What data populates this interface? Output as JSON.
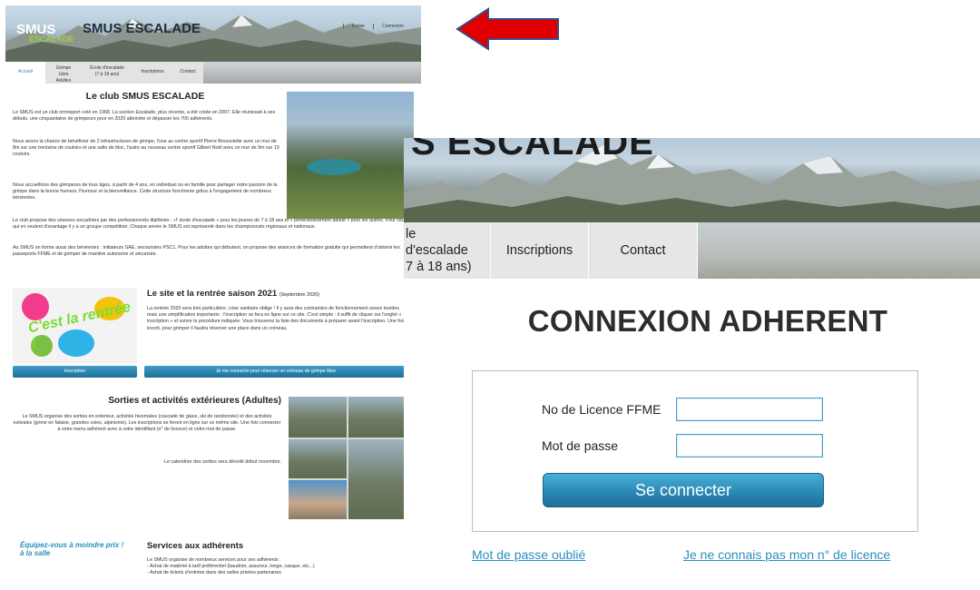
{
  "site": {
    "title": "SMUS ESCALADE",
    "logo_text": "SMUS",
    "logo_sub": "ESCALADE",
    "top_links": [
      "Panier",
      "Connexion"
    ],
    "nav": [
      {
        "label": "Accueil"
      },
      {
        "label": "Grimpe\nLibre Adultes"
      },
      {
        "label": "École d'escalade\n(7 à 18 ans)"
      },
      {
        "label": "Inscriptions"
      },
      {
        "label": "Contact"
      }
    ],
    "club": {
      "heading": "Le club SMUS ESCALADE",
      "p1": "Le SMUS est un club omnisport créé en 1968. La section Escalade, plus récente, a été créée en 2007. Elle réunissait à ses débuts, une cinquantaine de grimpeurs pour en 2020 atteindre et dépasser les 700 adhérents.",
      "p2": "Nous avons la chance de bénéficier de 2 infrastructures de grimpe, l'une au centre sportif Pierre Brossolette avec un mur de 8m sur une trentaine de couloirs et une salle de bloc, l'autre au nouveau centre sportif Gilbert Noël avec un mur de 9m sur 19 couloirs.",
      "p3": "Nous accueillons des grimpeurs de tous âges, à partir de 4 ans, en individuel ou en famille pour partager notre passion de la grimpe dans la bonne humeur, l'humour et la bienveillance. Cette structure fonctionne grâce à l'engagement de nombreux bénévoles.",
      "p4": "Le club propose des séances encadrées par des professionnels diplômés : «l' école d'escalade » pour les jeunes de 7 à 18 ans et « perfectionnement adulte » pour les autres. Pour ceux qui en veulent d'avantage il y a un groupe compétition. Chaque année le SMUS est représenté dans les championnats régionaux et nationaux.",
      "p5": "Au SMUS on forme aussi des bénévoles : initiateurs SAE, secouristes PSC1. Pour les adultes qui débutent, on propose des séances de formation gratuite qui permettent d'obtenir les passeports FFME et de grimper de manière autonome et sécurisée."
    },
    "rentree": {
      "image_text": "C'est la rentrée !",
      "heading": "Le site et la rentrée saison 2021",
      "heading_note": "(Septembre 2020)",
      "text": "La rentrée 2020 sera très particulière, crise sanitaire oblige ! Il y aura des contraintes de fonctionnement assez lourdes mais une simplification importante : l'inscription se fera en ligne sur ce site. C'est simple : il suffit de cliquer sur l'onglet « inscription » et suivre la procédure indiquée. Vous trouverez la liste des documents à préparer avant l'inscription. Une fois inscrit, pour grimper il faudra réserver une place dans un créneau.",
      "btn_inscription": "Inscription",
      "btn_reserver": "Je me connecte pour réserver un créneau de grimpe libre"
    },
    "sorties": {
      "heading": "Sorties et activités extérieures (Adultes)",
      "text": "Le SMUS organise des sorties en exterieur, activités hivernales (cascade de glace, ski de randonnée) et des activités estivales (grime en falaise, grandes voies, alpinisme). Les inscriptions se feront en ligne sur ce même site. Une fois connecter à votre menu adhérent avec à votre identifiant (n° de licence) et votre mot de passe.",
      "text2": "Le calendrier des sorties sera dévoilé début novembre."
    },
    "services": {
      "logo_text": "Équipez-vous à moindre prix ! à la salle",
      "heading": "Services aux adhérents",
      "text": "Le SMUS organise de nombreux services pour ses adhérents :\n- Achat de matériel à tarif préférentiel (baudrier, assureur, longe, casque, etc...)\n- Achat de tickets d'entrées dans des salles privées partenaires"
    }
  },
  "zoom": {
    "banner_title": "S ESCALADE",
    "nav": [
      {
        "label": "le d'escalade\n7 à 18 ans)"
      },
      {
        "label": "Inscriptions"
      },
      {
        "label": "Contact"
      }
    ],
    "heading": "CONNEXION ADHERENT",
    "license_label": "No de Licence FFME",
    "license_value": "",
    "password_label": "Mot de passe",
    "password_value": "",
    "submit_label": "Se connecter",
    "forgot_link": "Mot de passe oublié",
    "unknown_license_link": "Je ne connais pas mon n° de licence"
  },
  "colors": {
    "accent": "#2a8fc0",
    "button": "#2a89b7",
    "arrow": "#e00000"
  }
}
